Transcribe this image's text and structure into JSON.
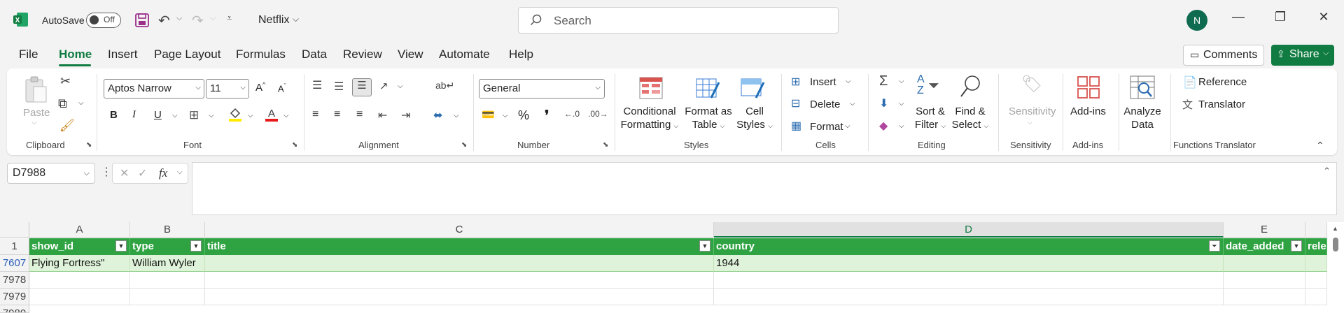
{
  "titlebar": {
    "autosave_label": "AutoSave",
    "autosave_state": "Off",
    "filename": "Netflix",
    "search_placeholder": "Search",
    "avatar_initial": "N"
  },
  "menu": {
    "tabs": [
      "File",
      "Home",
      "Insert",
      "Page Layout",
      "Formulas",
      "Data",
      "Review",
      "View",
      "Automate",
      "Help"
    ],
    "active": "Home",
    "comments_label": "Comments",
    "share_label": "Share"
  },
  "ribbon": {
    "clipboard": {
      "paste": "Paste",
      "label": "Clipboard"
    },
    "font": {
      "name": "Aptos Narrow",
      "size": "11",
      "label": "Font"
    },
    "alignment": {
      "label": "Alignment"
    },
    "number": {
      "format": "General",
      "label": "Number"
    },
    "styles": {
      "conditional_l1": "Conditional",
      "conditional_l2": "Formatting",
      "format_table_l1": "Format as",
      "format_table_l2": "Table",
      "cell_styles_l1": "Cell",
      "cell_styles_l2": "Styles",
      "label": "Styles"
    },
    "cells": {
      "insert": "Insert",
      "delete": "Delete",
      "format": "Format",
      "label": "Cells"
    },
    "editing": {
      "sort_l1": "Sort &",
      "sort_l2": "Filter",
      "find_l1": "Find &",
      "find_l2": "Select",
      "label": "Editing"
    },
    "sensitivity": {
      "button": "Sensitivity",
      "label": "Sensitivity"
    },
    "addins": {
      "button": "Add-ins",
      "label": "Add-ins"
    },
    "analyze": {
      "l1": "Analyze",
      "l2": "Data"
    },
    "functions_translator": {
      "reference": "Reference",
      "translator": "Translator",
      "label": "Functions Translator"
    }
  },
  "formula_bar": {
    "name_box": "D7988",
    "fx": "fx",
    "content": ""
  },
  "sheet": {
    "columns": [
      {
        "letter": "A",
        "header": "show_id",
        "selected": false
      },
      {
        "letter": "B",
        "header": "type",
        "selected": false
      },
      {
        "letter": "C",
        "header": "title",
        "selected": false
      },
      {
        "letter": "D",
        "header": "country",
        "selected": true,
        "filtered": true
      },
      {
        "letter": "E",
        "header": "date_added",
        "selected": false
      },
      {
        "letter": "",
        "header": "rele",
        "selected": false
      }
    ],
    "header_row_number": "1",
    "rows": [
      {
        "number": "7607",
        "cells": [
          "Flying Fortress\"",
          "William Wyler",
          "",
          "1944",
          "",
          ""
        ]
      },
      {
        "number": "7978",
        "cells": [
          "",
          "",
          "",
          "",
          "",
          ""
        ]
      },
      {
        "number": "7979",
        "cells": [
          "",
          "",
          "",
          "",
          "",
          ""
        ]
      },
      {
        "number": "7980",
        "cells": [
          "",
          "",
          "",
          "",
          "",
          ""
        ]
      }
    ]
  },
  "colors": {
    "accent": "#107c41",
    "header_fill": "#2fa342",
    "row_fill": "#dff3da"
  }
}
